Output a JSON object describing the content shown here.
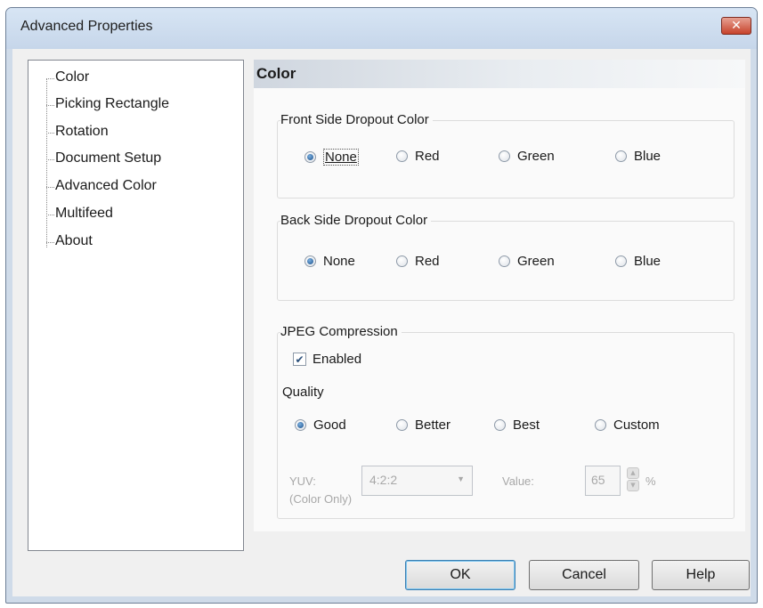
{
  "window": {
    "title": "Advanced Properties"
  },
  "tree": {
    "items": [
      {
        "label": "Color"
      },
      {
        "label": "Picking Rectangle"
      },
      {
        "label": "Rotation"
      },
      {
        "label": "Document Setup"
      },
      {
        "label": "Advanced Color"
      },
      {
        "label": "Multifeed"
      },
      {
        "label": "About"
      }
    ]
  },
  "panel": {
    "title": "Color",
    "front": {
      "label": "Front Side Dropout Color",
      "options": [
        "None",
        "Red",
        "Green",
        "Blue"
      ],
      "selected": "None"
    },
    "back": {
      "label": "Back Side Dropout Color",
      "options": [
        "None",
        "Red",
        "Green",
        "Blue"
      ],
      "selected": "None"
    },
    "jpeg": {
      "label": "JPEG Compression",
      "enabled_label": "Enabled",
      "enabled": true,
      "quality_label": "Quality",
      "quality_options": [
        "Good",
        "Better",
        "Best",
        "Custom"
      ],
      "quality_selected": "Good",
      "yuv_label": "YUV:",
      "yuv_note": "(Color Only)",
      "yuv_value": "4:2:2",
      "value_label": "Value:",
      "value": "65",
      "unit": "%"
    }
  },
  "buttons": {
    "ok": "OK",
    "cancel": "Cancel",
    "help": "Help"
  },
  "colors": {
    "accent": "#1a4f8a",
    "title_bar": "#c6d6ea",
    "close_button": "#c7432b"
  }
}
